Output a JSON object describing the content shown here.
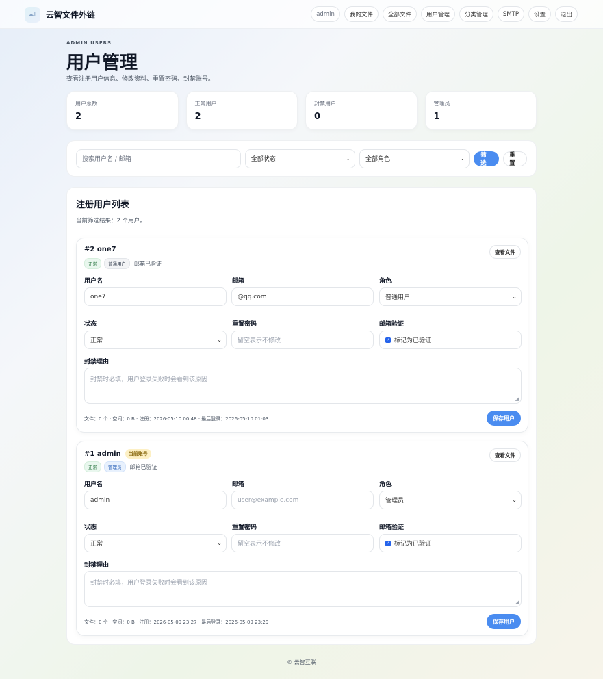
{
  "header": {
    "brand_logo_text": "☁L",
    "brand": "云智文件外链",
    "nav": [
      "admin",
      "我的文件",
      "全部文件",
      "用户管理",
      "分类管理",
      "SMTP",
      "设置",
      "退出"
    ]
  },
  "page": {
    "eyebrow": "ADMIN USERS",
    "title": "用户管理",
    "subtitle": "查看注册用户信息、修改资料、重置密码、封禁账号。"
  },
  "stats": [
    {
      "label": "用户总数",
      "value": "2"
    },
    {
      "label": "正常用户",
      "value": "2"
    },
    {
      "label": "封禁用户",
      "value": "0"
    },
    {
      "label": "管理员",
      "value": "1"
    }
  ],
  "filter": {
    "search_placeholder": "搜索用户名 / 邮箱",
    "status_value": "全部状态",
    "role_value": "全部角色",
    "filter_label": "筛选",
    "reset_label": "重置"
  },
  "list": {
    "title": "注册用户列表",
    "subtitle": "当前筛选结果：2 个用户。"
  },
  "labels": {
    "username": "用户名",
    "email": "邮箱",
    "role": "角色",
    "status": "状态",
    "reset_password": "重置密码",
    "email_verify": "邮箱验证",
    "ban_reason": "封禁理由",
    "view_files": "查看文件",
    "save": "保存用户",
    "password_placeholder": "留空表示不修改",
    "verified_check": "标记为已验证",
    "ban_placeholder": "封禁时必填，用户登录失败时会看到该原因"
  },
  "users": [
    {
      "title": "#2 one7",
      "current_badge": "",
      "status_badge": "正常",
      "role_badge": "普通用户",
      "verify_note": "邮箱已验证",
      "username": "one7",
      "email": "@qq.com",
      "email_is_placeholder": false,
      "role": "普通用户",
      "status": "正常",
      "meta": "文件：0 个 · 空间：0 B · 注册：2026-05-10 00:48 · 最后登录：2026-05-10 01:03"
    },
    {
      "title": "#1 admin",
      "current_badge": "当前账号",
      "status_badge": "正常",
      "role_badge": "管理员",
      "verify_note": "邮箱已验证",
      "username": "admin",
      "email": "user@example.com",
      "email_is_placeholder": true,
      "role": "管理员",
      "status": "正常",
      "meta": "文件：0 个 · 空间：0 B · 注册：2026-05-09 23:27 · 最后登录：2026-05-09 23:29"
    }
  ],
  "footer": "© 云智互联",
  "colors": {
    "primary": "#4a8cf0",
    "badge_green": "#2f7a46",
    "badge_blue": "#2b62b8",
    "current_badge_bg": "#fdf0c4"
  }
}
